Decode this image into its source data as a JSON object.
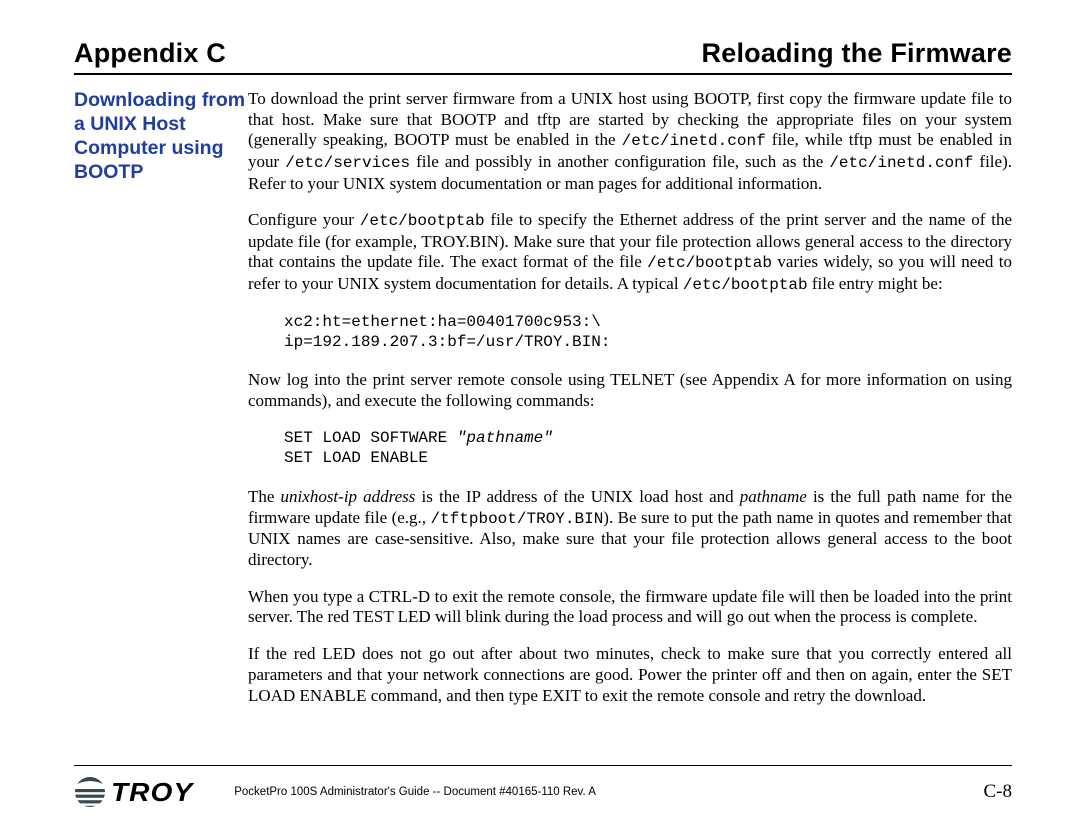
{
  "header": {
    "left": "Appendix C",
    "right": "Reloading the Firmware"
  },
  "sidebar": {
    "heading": "Downloading from a UNIX Host Computer using BOOTP"
  },
  "paragraphs": {
    "p1a": "To download the print server firmware from a UNIX host using BOOTP, first copy the firmware update file to that host.  Make sure that BOOTP and tftp are started by checking the appropriate files on your system (generally speaking, BOOTP must be enabled in the ",
    "p1_code1": "/etc/inetd.conf",
    "p1b": " file, while tftp must be enabled in your ",
    "p1_code2": "/etc/services",
    "p1c": " file and possibly in another configuration file, such as the ",
    "p1_code3": "/etc/inetd.conf",
    "p1d": " file).  Refer to your UNIX system documentation or man pages for additional information.",
    "p2a": "Configure your ",
    "p2_code1": "/etc/bootptab",
    "p2b": " file to specify the Ethernet address of the print server and the name of the update file (for example, TROY.BIN).  Make sure that your file protection allows general access to the directory that contains the update file.  The exact format of the file ",
    "p2_code2": "/etc/bootptab",
    "p2c": " varies widely, so you will need to refer to your UNIX system documentation for details.  A typical ",
    "p2_code3": "/etc/bootptab",
    "p2d": " file entry might be:",
    "code1": "xc2:ht=ethernet:ha=00401700c953:\\\nip=192.189.207.3:bf=/usr/TROY.BIN:",
    "p3": "Now log into the print server remote console using TELNET (see Appendix A for more information on using commands), and execute the following commands:",
    "code2a": "SET LOAD SOFTWARE ",
    "code2_ital": "\"pathname\"",
    "code2b": "\nSET LOAD ENABLE",
    "p4a": "The ",
    "p4_ital1": "unixhost-ip address",
    "p4b": " is the IP address of the UNIX load host and ",
    "p4_ital2": "pathname",
    "p4c": " is the full path name for the firmware update file (e.g., ",
    "p4_code1": "/tftpboot/TROY.BIN",
    "p4d": ").  Be sure to put the path name in quotes and remember that UNIX names are case-sensitive.  Also, make sure that your file protection allows general access to the boot directory.",
    "p5": "When you type a CTRL-D to exit the remote console, the firmware update file will then be loaded into the print server.  The red TEST LED will blink during the load process and will go out when the process is complete.",
    "p6": "If the red LED does not go out after about two minutes, check to make sure that you correctly entered all parameters and that your network connections are good.  Power the printer off and then on again, enter the SET LOAD ENABLE command, and then type EXIT to exit the remote console and retry the download."
  },
  "footer": {
    "doc": "PocketPro 100S Administrator's Guide -- Document #40165-110  Rev. A",
    "page": "C-8",
    "logo_text": "TROY"
  }
}
